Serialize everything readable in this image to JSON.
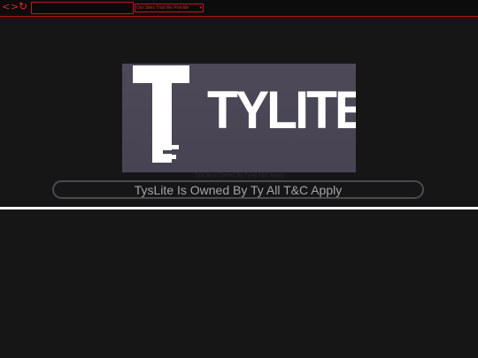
{
  "toolbar": {
    "back_label": "<",
    "forward_label": ">",
    "reload_label": "↻",
    "url_value": "",
    "site_select_value": "Our Sites That We Provide"
  },
  "hero": {
    "logo_text": "TYLITE",
    "caption": "TysLite Is Owned By Ty All T&C Apply"
  },
  "banner": {
    "text": "TysLite Is Owned By Ty All T&C Apply"
  },
  "colors": {
    "accent": "#e0262f",
    "background": "#161617",
    "hero_bg": "#4a4655"
  }
}
